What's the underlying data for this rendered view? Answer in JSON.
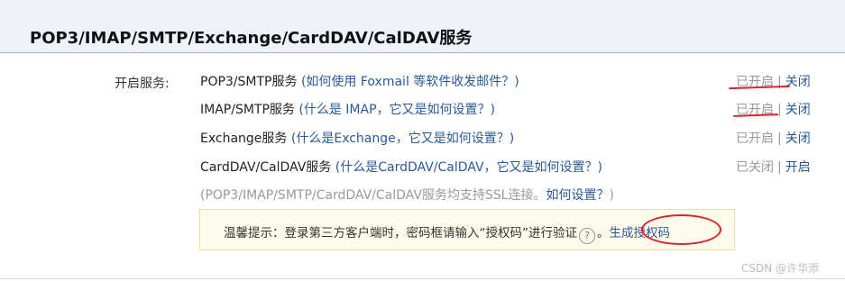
{
  "header": {
    "title": "POP3/IMAP/SMTP/Exchange/CardDAV/CalDAV服务"
  },
  "label": "开启服务:",
  "services": [
    {
      "name": "POP3/SMTP服务",
      "help": "如何使用 Foxmail 等软件收发邮件？",
      "state": "已开启",
      "action": "关闭"
    },
    {
      "name": "IMAP/SMTP服务",
      "help": "什么是 IMAP，它又是如何设置？",
      "state": "已开启",
      "action": "关闭"
    },
    {
      "name": "Exchange服务",
      "help": "什么是Exchange，它又是如何设置？",
      "state": "已开启",
      "action": "关闭"
    },
    {
      "name": "CardDAV/CalDAV服务",
      "help": "什么是CardDAV/CalDAV，它又是如何设置？",
      "state": "已关闭",
      "action": "开启"
    }
  ],
  "ssl_note": {
    "text": "(POP3/IMAP/SMTP/CardDAV/CalDAV服务均支持SSL连接。",
    "link": "如何设置？",
    "close": ")"
  },
  "tip": {
    "text": "温馨提示：登录第三方客户端时，密码框请输入“授权码”进行验证",
    "icon": "question-circle-icon",
    "question_glyph": "?",
    "after_icon": "。",
    "link": "生成授权码"
  },
  "separator": "|",
  "paren_open": "(",
  "paren_close": ")",
  "watermark": "CSDN @许华添",
  "colors": {
    "header_bg": "#eef3fb",
    "link": "#2a5a9a",
    "annotation": "#d9232d",
    "tip_bg": "#fffbea"
  }
}
